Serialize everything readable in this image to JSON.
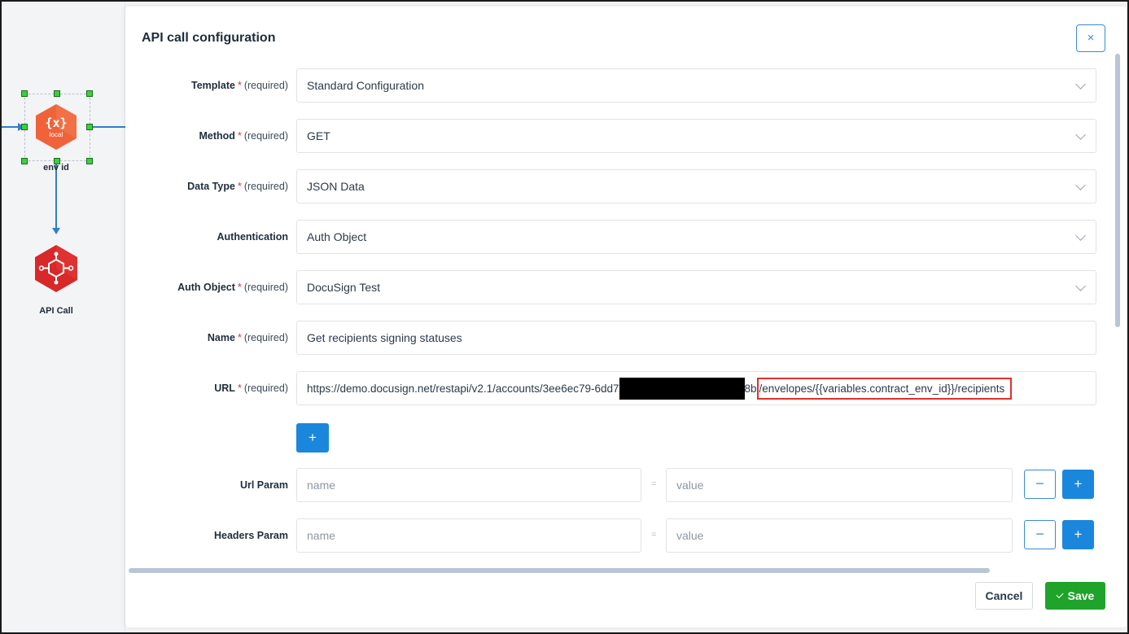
{
  "canvas": {
    "nodes": [
      {
        "label": "env id",
        "icon_text": "{x}",
        "icon_sub": "local",
        "color": "#f0633a"
      },
      {
        "label": "API Call",
        "color": "#d8282a"
      }
    ]
  },
  "modal": {
    "title": "API call configuration",
    "close_label": "×",
    "required_text": "(required)",
    "required_star": "*",
    "fields": {
      "template": {
        "label": "Template",
        "value": "Standard Configuration"
      },
      "method": {
        "label": "Method",
        "value": "GET"
      },
      "data_type": {
        "label": "Data Type",
        "value": "JSON Data"
      },
      "authentication": {
        "label": "Authentication",
        "value": "Auth Object"
      },
      "auth_object": {
        "label": "Auth Object",
        "value": "DocuSign Test"
      },
      "name": {
        "label": "Name",
        "value": "Get recipients signing statuses"
      },
      "url": {
        "label": "URL",
        "value_start": "https://demo.docusign.net/restapi/v2.1/accounts/3ee6ec79-6dd7",
        "value_after_redaction": "8b",
        "value_highlighted": "/envelopes/{{variables.contract_env_id}}/recipients"
      }
    },
    "add_label": "+",
    "params": [
      {
        "label": "Url Param",
        "name_placeholder": "name",
        "value_placeholder": "value",
        "eq": "=",
        "minus": "−",
        "plus": "+"
      },
      {
        "label": "Headers Param",
        "name_placeholder": "name",
        "value_placeholder": "value",
        "eq": "=",
        "minus": "−",
        "plus": "+"
      }
    ],
    "buttons": {
      "cancel": "Cancel",
      "save": "Save"
    }
  },
  "colors": {
    "accent": "#1b87dc",
    "save": "#1fa32a",
    "required": "#e0302b"
  }
}
